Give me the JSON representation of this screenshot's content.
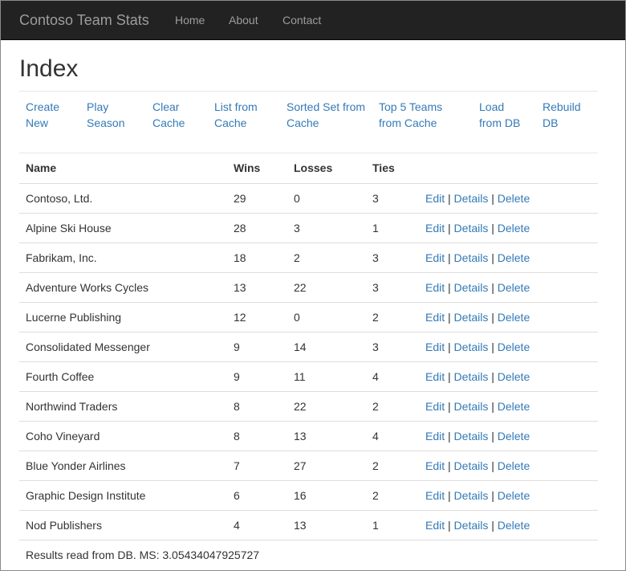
{
  "navbar": {
    "brand": "Contoso Team Stats",
    "links": [
      "Home",
      "About",
      "Contact"
    ]
  },
  "page": {
    "title": "Index",
    "actions": [
      "Create New",
      "Play Season",
      "Clear Cache",
      "List from Cache",
      "Sorted Set from Cache",
      "Top 5 Teams from Cache",
      "Load from DB",
      "Rebuild DB"
    ]
  },
  "table": {
    "headers": [
      "Name",
      "Wins",
      "Losses",
      "Ties"
    ],
    "row_links": [
      "Edit",
      "Details",
      "Delete"
    ],
    "separator": "|",
    "rows": [
      [
        "Contoso, Ltd.",
        "29",
        "0",
        "3"
      ],
      [
        "Alpine Ski House",
        "28",
        "3",
        "1"
      ],
      [
        "Fabrikam, Inc.",
        "18",
        "2",
        "3"
      ],
      [
        "Adventure Works Cycles",
        "13",
        "22",
        "3"
      ],
      [
        "Lucerne Publishing",
        "12",
        "0",
        "2"
      ],
      [
        "Consolidated Messenger",
        "9",
        "14",
        "3"
      ],
      [
        "Fourth Coffee",
        "9",
        "11",
        "4"
      ],
      [
        "Northwind Traders",
        "8",
        "22",
        "2"
      ],
      [
        "Coho Vineyard",
        "8",
        "13",
        "4"
      ],
      [
        "Blue Yonder Airlines",
        "7",
        "27",
        "2"
      ],
      [
        "Graphic Design Institute",
        "6",
        "16",
        "2"
      ],
      [
        "Nod Publishers",
        "4",
        "13",
        "1"
      ]
    ],
    "footer": "Results read from DB. MS: 3.05434047925727"
  },
  "colors": {
    "navbar_bg": "#222222",
    "link": "#337ab7",
    "nav_text": "#9d9d9d"
  }
}
